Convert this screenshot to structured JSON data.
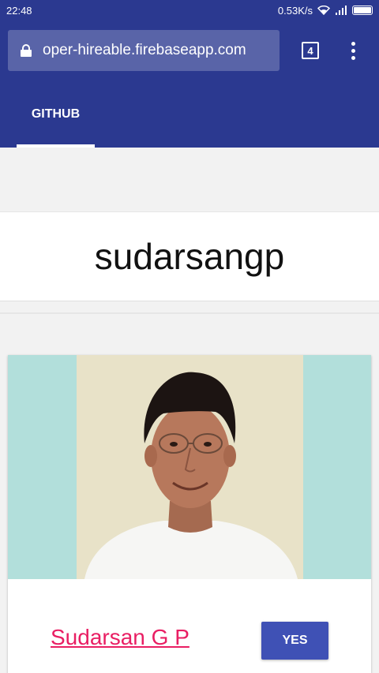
{
  "status_bar": {
    "time": "22:48",
    "network_speed": "0.53K/s",
    "icons": [
      "wifi-icon",
      "signal-icon",
      "battery-icon"
    ]
  },
  "browser": {
    "url": "oper-hireable.firebaseapp.com",
    "tab_count": "4",
    "icons": [
      "lock-icon",
      "overflow-menu-icon"
    ]
  },
  "tabs": [
    {
      "label": "GITHUB",
      "active": true
    }
  ],
  "search": {
    "username": "sudarsangp"
  },
  "profile": {
    "name": "Sudarsan G P",
    "hireable_label": "YES"
  },
  "colors": {
    "primary": "#2b3990",
    "accent": "#e91e63",
    "button": "#3f51b5",
    "photo_bg": "#b2dfdb"
  }
}
